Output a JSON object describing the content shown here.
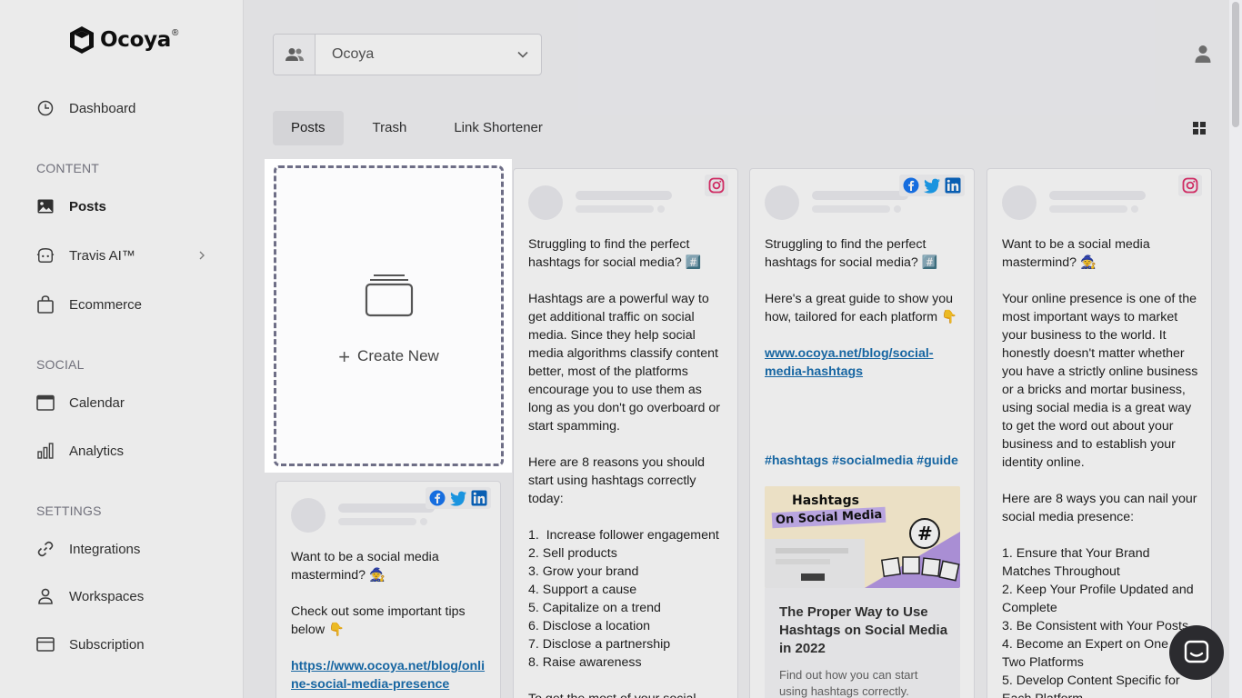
{
  "brand": {
    "name": "Ocoya",
    "reg": "®"
  },
  "sidebar": {
    "top_items": [
      {
        "label": "Dashboard",
        "icon": "clock-icon"
      }
    ],
    "sections": [
      {
        "label": "CONTENT",
        "items": [
          {
            "label": "Posts",
            "icon": "image-icon",
            "active": true
          },
          {
            "label": "Travis AI™",
            "icon": "robot-icon"
          },
          {
            "label": "Ecommerce",
            "icon": "shopping-bag-icon"
          }
        ]
      },
      {
        "label": "SOCIAL",
        "items": [
          {
            "label": "Calendar",
            "icon": "calendar-icon"
          },
          {
            "label": "Analytics",
            "icon": "bar-chart-icon"
          }
        ]
      },
      {
        "label": "SETTINGS",
        "items": [
          {
            "label": "Integrations",
            "icon": "link-icon"
          },
          {
            "label": "Workspaces",
            "icon": "person-icon"
          },
          {
            "label": "Subscription",
            "icon": "credit-card-icon"
          }
        ]
      }
    ]
  },
  "workspace": {
    "value": "Ocoya"
  },
  "tabs": [
    {
      "label": "Posts",
      "active": true
    },
    {
      "label": "Trash"
    },
    {
      "label": "Link Shortener"
    }
  ],
  "create_new": {
    "label": "Create New"
  },
  "cards": {
    "c1": {
      "text": "Want to be a social media mastermind? 🧙\n\nCheck out some important tips below 👇\n\n",
      "link": "https://www.ocoya.net/blog/online-social-media-presence",
      "link_line1": "https://www.ocoya.net/blog/onli",
      "link_line2": "ne-social-media-presence"
    },
    "c2": {
      "text": "Struggling to find the perfect hashtags for social media? #️⃣\n\nHashtags are a powerful way to get additional traffic on social media. Since they help social media algorithms classify content better, most of the platforms encourage you to use them as long as you don't go overboard or start spamming.\n\nHere are 8 reasons you should start using hashtags correctly today:\n\n1.  Increase follower engagement\n2. Sell products\n3. Grow your brand\n4. Support a cause\n5. Capitalize on a trend\n6. Disclose a location\n7. Disclose a partnership\n8. Raise awareness\n\nTo get the most of your social"
    },
    "c3": {
      "text": "Struggling to find the perfect hashtags for social media? #️⃣\n\nHere's a great guide to show you how, tailored for each platform 👇\n\n",
      "link_line1": "www.ocoya.net/blog/social-",
      "link_line2": "media-hashtags",
      "hashtags": "#hashtags #socialmedia #guide",
      "image_title_line1": "Hashtags",
      "image_title_line2": "On Social Media",
      "preview_title": "The Proper Way to Use Hashtags on Social Media in 2022",
      "preview_desc": "Find out how you can start using hashtags correctly."
    },
    "c4": {
      "text": "Want to be a social media mastermind? 🧙\n\nYour online presence is one of the most important ways to market your business to the world. It honestly doesn't matter whether you have a strictly online business or a bricks and mortar business, using social media is a great way to get the word out about your business and to establish your identity online.\n\nHere are 8 ways you can nail your social media presence:\n\n1. Ensure that Your Brand Matches Throughout\n2. Keep Your Profile Updated and Complete\n3. Be Consistent with Your Posts\n4. Become an Expert on One or Two Platforms\n5. Develop Content Specific for Each Platform"
    }
  },
  "colors": {
    "instagram": "#e1306c",
    "facebook": "#1877f2",
    "twitter": "#1da1f2",
    "linkedin": "#0a66c2",
    "link": "#1a6fb0"
  }
}
